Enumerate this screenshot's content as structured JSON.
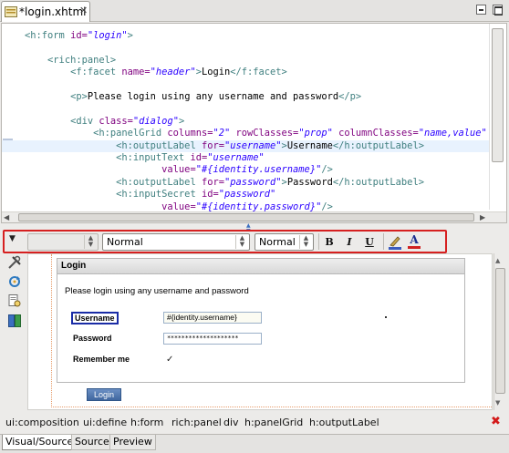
{
  "tab": {
    "title": "*login.xhtml",
    "close": "✕"
  },
  "code_lines": [
    [
      {
        "c": "tg",
        "t": "    <h:form "
      },
      {
        "c": "at",
        "t": "id="
      },
      {
        "c": "vl",
        "t": "\"login\""
      },
      {
        "c": "tg",
        "t": ">"
      }
    ],
    [],
    [
      {
        "c": "tg",
        "t": "        <rich:panel>"
      }
    ],
    [
      {
        "c": "tg",
        "t": "            <f:facet "
      },
      {
        "c": "at",
        "t": "name="
      },
      {
        "c": "vl",
        "t": "\"header\""
      },
      {
        "c": "tg",
        "t": ">"
      },
      {
        "c": "tx",
        "t": "Login"
      },
      {
        "c": "tg",
        "t": "</f:facet>"
      }
    ],
    [],
    [
      {
        "c": "tg",
        "t": "            <p>"
      },
      {
        "c": "tx",
        "t": "Please login using any username and password"
      },
      {
        "c": "tg",
        "t": "</p>"
      }
    ],
    [],
    [
      {
        "c": "tg",
        "t": "            <div "
      },
      {
        "c": "at",
        "t": "class="
      },
      {
        "c": "vl",
        "t": "\"dialog\""
      },
      {
        "c": "tg",
        "t": ">"
      }
    ],
    [
      {
        "c": "tg",
        "t": "                <h:panelGrid "
      },
      {
        "c": "at",
        "t": "columns="
      },
      {
        "c": "vl",
        "t": "\"2\" "
      },
      {
        "c": "at",
        "t": "rowClasses="
      },
      {
        "c": "vl",
        "t": "\"prop\" "
      },
      {
        "c": "at",
        "t": "columnClasses="
      },
      {
        "c": "vl",
        "t": "\"name,value\""
      }
    ],
    [
      {
        "c": "tg",
        "t": "                    <h:outputLabel "
      },
      {
        "c": "at",
        "t": "for="
      },
      {
        "c": "vl",
        "t": "\"username\""
      },
      {
        "c": "tg",
        "t": ">"
      },
      {
        "c": "tx",
        "t": "Username"
      },
      {
        "c": "tg",
        "t": "</h:outputLabel>"
      }
    ],
    [
      {
        "c": "tg",
        "t": "                    <h:inputText "
      },
      {
        "c": "at",
        "t": "id="
      },
      {
        "c": "vl",
        "t": "\"username\""
      }
    ],
    [
      {
        "c": "at",
        "t": "                            value="
      },
      {
        "c": "vl",
        "t": "\"#{identity.username}\""
      },
      {
        "c": "tg",
        "t": "/>"
      }
    ],
    [
      {
        "c": "tg",
        "t": "                    <h:outputLabel "
      },
      {
        "c": "at",
        "t": "for="
      },
      {
        "c": "vl",
        "t": "\"password\""
      },
      {
        "c": "tg",
        "t": ">"
      },
      {
        "c": "tx",
        "t": "Password"
      },
      {
        "c": "tg",
        "t": "</h:outputLabel>"
      }
    ],
    [
      {
        "c": "tg",
        "t": "                    <h:inputSecret "
      },
      {
        "c": "at",
        "t": "id="
      },
      {
        "c": "vl",
        "t": "\"password\""
      }
    ],
    [
      {
        "c": "at",
        "t": "                            value="
      },
      {
        "c": "vl",
        "t": "\"#{identity.password}\""
      },
      {
        "c": "tg",
        "t": "/>"
      }
    ]
  ],
  "toolbar": {
    "style_value": "",
    "format_value": "Normal",
    "size_value": "Normal",
    "bold": "B",
    "italic": "I",
    "underline": "U",
    "fontcolor": "A"
  },
  "preview": {
    "panel_header": "Login",
    "intro": "Please login using any username and password",
    "username_label": "Username",
    "username_value": "#{identity.username}",
    "password_label": "Password",
    "password_value": "********************",
    "remember_label": "Remember me",
    "remember_checked": "✓",
    "login_button": "Login"
  },
  "breadcrumbs": [
    "ui:composition",
    "ui:define",
    "h:form",
    "rich:panel",
    "div",
    "h:panelGrid",
    "h:outputLabel"
  ],
  "bottom_tabs": [
    "Visual/Source",
    "Source",
    "Preview"
  ],
  "colors": {
    "tag": "#3f7f7f",
    "attribute": "#7f007f",
    "value": "#2a00ff",
    "highlight": "#d62020",
    "login_button": "#40679f"
  }
}
